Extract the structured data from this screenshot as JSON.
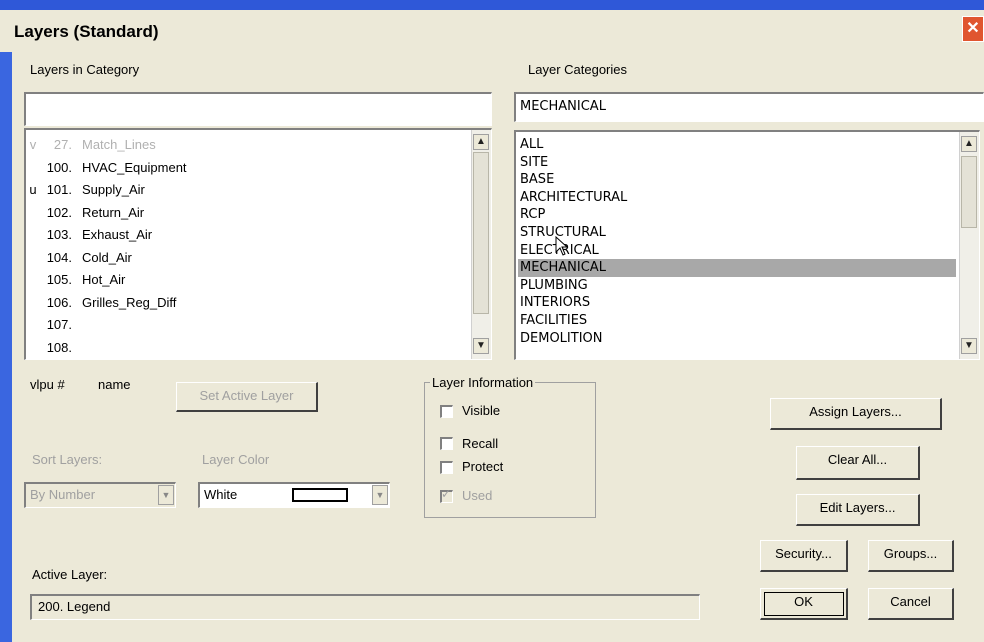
{
  "window": {
    "title": "Layers (Standard)",
    "close_glyph": "✕"
  },
  "layers_panel": {
    "label": "Layers in Category",
    "filter_value": "",
    "rows": [
      {
        "flag": "v",
        "number": "27.",
        "name": "Match_Lines",
        "dim": true
      },
      {
        "flag": "",
        "number": "100.",
        "name": "HVAC_Equipment",
        "dim": false
      },
      {
        "flag": "u",
        "number": "101.",
        "name": "Supply_Air",
        "dim": false
      },
      {
        "flag": "",
        "number": "102.",
        "name": "Return_Air",
        "dim": false
      },
      {
        "flag": "",
        "number": "103.",
        "name": "Exhaust_Air",
        "dim": false
      },
      {
        "flag": "",
        "number": "104.",
        "name": "Cold_Air",
        "dim": false
      },
      {
        "flag": "",
        "number": "105.",
        "name": "Hot_Air",
        "dim": false
      },
      {
        "flag": "",
        "number": "106.",
        "name": "Grilles_Reg_Diff",
        "dim": false
      },
      {
        "flag": "",
        "number": "107.",
        "name": "",
        "dim": false
      },
      {
        "flag": "",
        "number": "108.",
        "name": "",
        "dim": false
      }
    ],
    "col_vlpu": "vlpu #",
    "col_name": "name"
  },
  "categories_panel": {
    "label": "Layer Categories",
    "current_value": "MECHANICAL",
    "items": [
      "ALL",
      "SITE",
      "BASE",
      "ARCHITECTURAL",
      "RCP",
      "STRUCTURAL",
      "ELECTRICAL",
      "MECHANICAL",
      "PLUMBING",
      "INTERIORS",
      "FACILITIES",
      "DEMOLITION"
    ],
    "selected": "MECHANICAL"
  },
  "buttons": {
    "set_active_layer": "Set Active Layer",
    "assign_layers": "Assign Layers...",
    "clear_all": "Clear All...",
    "edit_layers": "Edit Layers...",
    "security": "Security...",
    "groups": "Groups...",
    "ok": "OK",
    "cancel": "Cancel"
  },
  "sort": {
    "label": "Sort Layers:",
    "value": "By Number"
  },
  "color": {
    "label": "Layer Color",
    "value": "White"
  },
  "layer_info": {
    "title": "Layer Information",
    "visible": "Visible",
    "recall": "Recall",
    "protect": "Protect",
    "used": "Used"
  },
  "active_layer": {
    "label": "Active Layer:",
    "value": "200.  Legend"
  },
  "icons": {
    "up": "▲",
    "down": "▼"
  }
}
